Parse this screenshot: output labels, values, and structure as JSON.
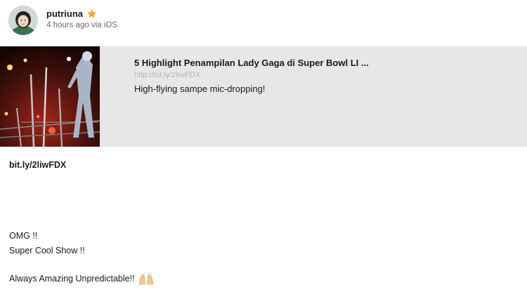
{
  "post": {
    "author": {
      "username": "putriuna",
      "badge_icon": "star-icon",
      "badge_color": "#f5a623"
    },
    "meta": "4 hours ago via iOS",
    "link_card": {
      "title": "5 Highlight Penampilan Lady Gaga di Super Bowl LI ...",
      "url": "http://bit.ly/2liwFDX",
      "description": "High-flying sampe mic-dropping!",
      "background": "#e7e7e7"
    },
    "short_link": "bit.ly/2liwFDX",
    "body": {
      "line_1": "OMG !!",
      "line_2": "Super Cool Show !!",
      "line_3": "Always Amazing Unpredictable!!",
      "line_3_emoji": "raising-hands-icon"
    }
  }
}
